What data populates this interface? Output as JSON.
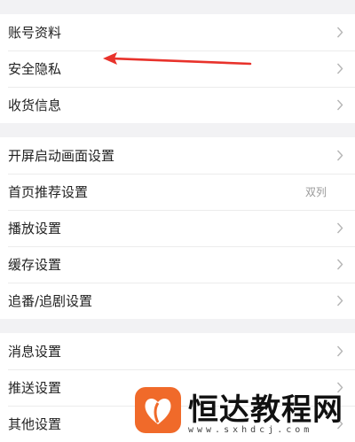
{
  "groups": [
    {
      "items": [
        {
          "label": "账号资料"
        },
        {
          "label": "安全隐私"
        },
        {
          "label": "收货信息"
        }
      ]
    },
    {
      "items": [
        {
          "label": "开屏启动画面设置"
        },
        {
          "label": "首页推荐设置",
          "value": "双列"
        },
        {
          "label": "播放设置"
        },
        {
          "label": "缓存设置"
        },
        {
          "label": "追番/追剧设置"
        }
      ]
    },
    {
      "items": [
        {
          "label": "消息设置"
        },
        {
          "label": "推送设置"
        },
        {
          "label": "其他设置"
        }
      ]
    }
  ],
  "annotation": {
    "color": "#e8322b"
  },
  "watermark": {
    "brand": "恒达教程网",
    "url": "www.sxhdcj.com",
    "logo_color": "#f06a2a",
    "icon": "heart-leaf-logo"
  },
  "icons": {
    "row_chevron": "chevron-right-icon"
  }
}
